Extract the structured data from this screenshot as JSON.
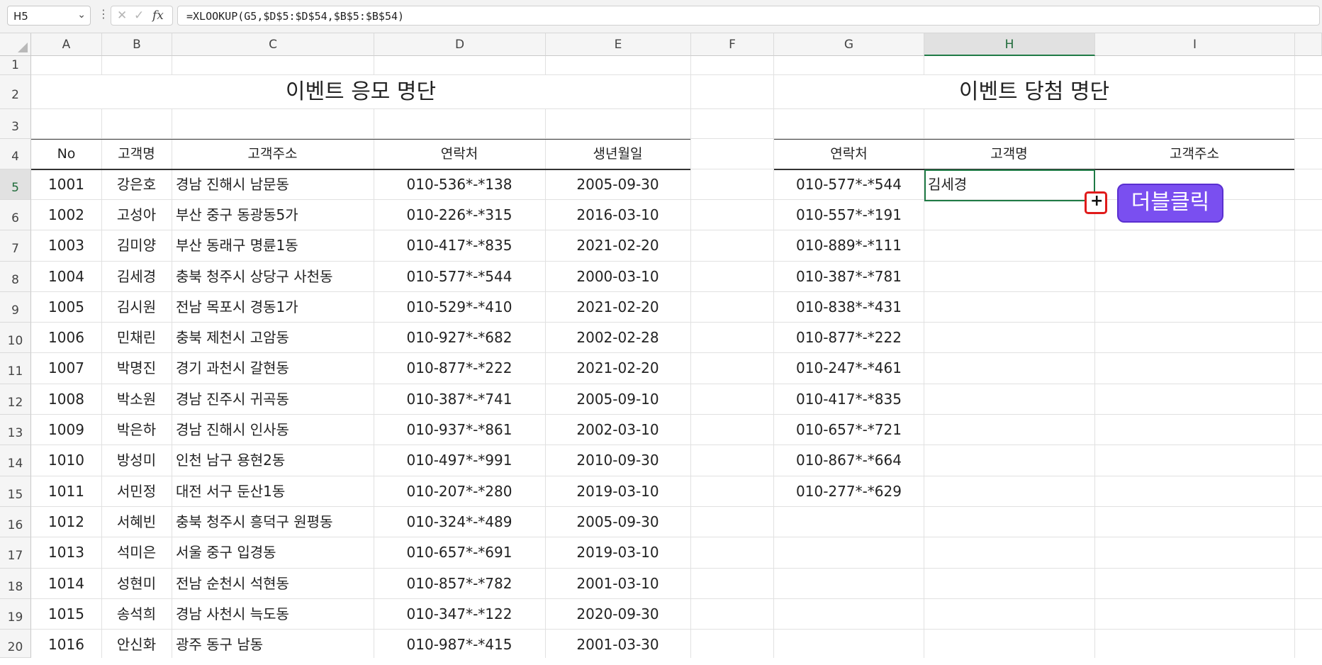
{
  "formula_bar": {
    "name_box": "H5",
    "formula": "=XLOOKUP(G5,$D$5:$D$54,$B$5:$B$54)"
  },
  "columns": [
    "A",
    "B",
    "C",
    "D",
    "E",
    "F",
    "G",
    "H",
    "I"
  ],
  "selected_column": "H",
  "rows": [
    "1",
    "2",
    "3",
    "4",
    "5",
    "6",
    "7",
    "8",
    "9",
    "10",
    "11",
    "12",
    "13",
    "14",
    "15",
    "16",
    "17",
    "18",
    "19",
    "20"
  ],
  "selected_row": "5",
  "left_table": {
    "title": "이벤트 응모 명단",
    "headers": [
      "No",
      "고객명",
      "고객주소",
      "연락처",
      "생년월일"
    ],
    "rows": [
      [
        "1001",
        "강은호",
        "경남 진해시 남문동",
        "010-536*-*138",
        "2005-09-30"
      ],
      [
        "1002",
        "고성아",
        "부산 중구 동광동5가",
        "010-226*-*315",
        "2016-03-10"
      ],
      [
        "1003",
        "김미양",
        "부산 동래구 명륜1동",
        "010-417*-*835",
        "2021-02-20"
      ],
      [
        "1004",
        "김세경",
        "충북 청주시 상당구 사천동",
        "010-577*-*544",
        "2000-03-10"
      ],
      [
        "1005",
        "김시원",
        "전남 목포시 경동1가",
        "010-529*-*410",
        "2021-02-20"
      ],
      [
        "1006",
        "민채린",
        "충북 제천시 고암동",
        "010-927*-*682",
        "2002-02-28"
      ],
      [
        "1007",
        "박명진",
        "경기 과천시 갈현동",
        "010-877*-*222",
        "2021-02-20"
      ],
      [
        "1008",
        "박소원",
        "경남 진주시 귀곡동",
        "010-387*-*741",
        "2005-09-10"
      ],
      [
        "1009",
        "박은하",
        "경남 진해시 인사동",
        "010-937*-*861",
        "2002-03-10"
      ],
      [
        "1010",
        "방성미",
        "인천 남구 용현2동",
        "010-497*-*991",
        "2010-09-30"
      ],
      [
        "1011",
        "서민정",
        "대전 서구 둔산1동",
        "010-207*-*280",
        "2019-03-10"
      ],
      [
        "1012",
        "서혜빈",
        "충북 청주시 흥덕구 원평동",
        "010-324*-*489",
        "2005-09-30"
      ],
      [
        "1013",
        "석미은",
        "서울 중구 입경동",
        "010-657*-*691",
        "2019-03-10"
      ],
      [
        "1014",
        "성현미",
        "전남 순천시 석현동",
        "010-857*-*782",
        "2001-03-10"
      ],
      [
        "1015",
        "송석희",
        "경남 사천시 늑도동",
        "010-347*-*122",
        "2020-09-30"
      ],
      [
        "1016",
        "안신화",
        "광주 동구 남동",
        "010-987*-*415",
        "2001-03-30"
      ]
    ]
  },
  "right_table": {
    "title": "이벤트 당첨 명단",
    "headers": [
      "연락처",
      "고객명",
      "고객주소"
    ],
    "rows": [
      [
        "010-577*-*544",
        "김세경",
        ""
      ],
      [
        "010-557*-*191",
        "",
        ""
      ],
      [
        "010-889*-*111",
        "",
        ""
      ],
      [
        "010-387*-*781",
        "",
        ""
      ],
      [
        "010-838*-*431",
        "",
        ""
      ],
      [
        "010-877*-*222",
        "",
        ""
      ],
      [
        "010-247*-*461",
        "",
        ""
      ],
      [
        "010-417*-*835",
        "",
        ""
      ],
      [
        "010-657*-*721",
        "",
        ""
      ],
      [
        "010-867*-*664",
        "",
        ""
      ],
      [
        "010-277*-*629",
        "",
        ""
      ]
    ]
  },
  "annotation": {
    "callout_text": "더블클릭",
    "fill_handle_symbol": "+"
  },
  "colors": {
    "selection": "#1f7a45",
    "callout_bg": "#7a4ff0",
    "highlight_border": "#e01b1b"
  }
}
